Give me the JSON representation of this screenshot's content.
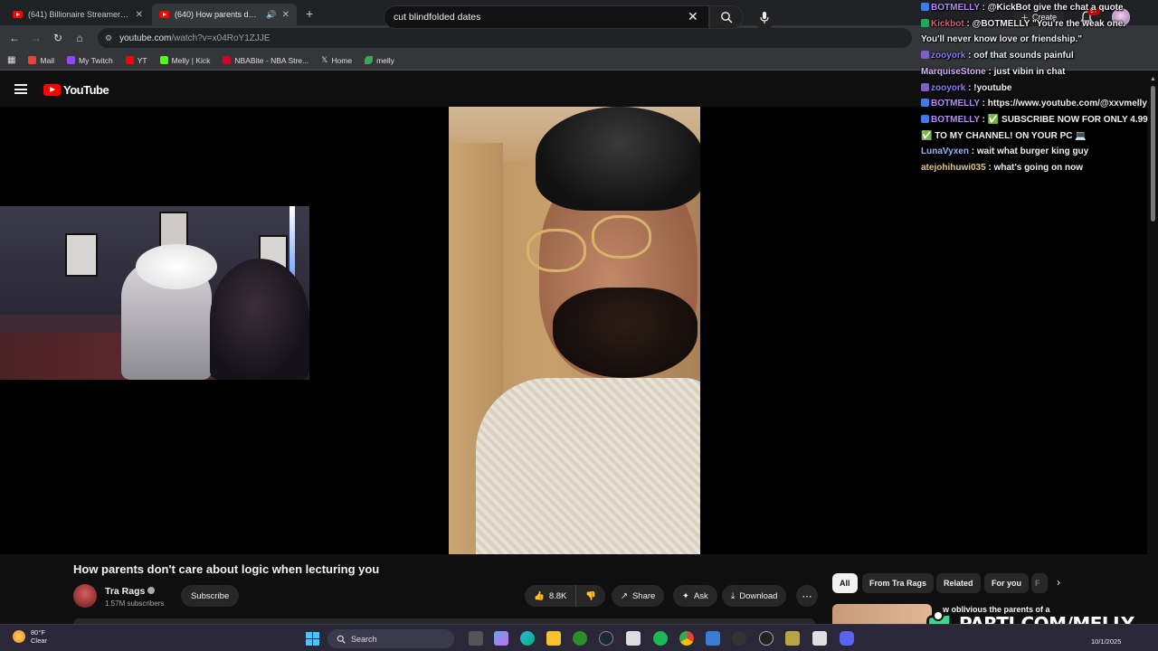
{
  "browser": {
    "tabs": [
      {
        "title": "(641) Billionaire Streamer Got C",
        "active": false
      },
      {
        "title": "(640) How parents don't ca",
        "active": true
      }
    ],
    "address": {
      "domain": "youtube.com",
      "path": "/watch?v=x04RoY1ZJJE"
    },
    "bookmarks": [
      {
        "label": "Mail",
        "icon": "gmail-icon",
        "color": "#ea4335"
      },
      {
        "label": "My Twitch",
        "icon": "twitch-icon",
        "color": "#9146ff"
      },
      {
        "label": "YT",
        "icon": "youtube-icon",
        "color": "#ff0000"
      },
      {
        "label": "Melly | Kick",
        "icon": "kick-icon",
        "color": "#53fc18"
      },
      {
        "label": "NBABite - NBA Stre...",
        "icon": "nba-icon",
        "color": "#c9082a"
      },
      {
        "label": "Home",
        "icon": "x-icon",
        "color": "#ffffff"
      },
      {
        "label": "melly",
        "icon": "leaf-icon",
        "color": "#3aa655"
      }
    ]
  },
  "youtube": {
    "logo_text": "YouTube",
    "search_query": "cut blindfolded dates",
    "create_label": "Create",
    "notification_count": "9+",
    "video": {
      "title": "How parents don't care about logic when lecturing you",
      "channel": "Tra Rags",
      "subscribers": "1.57M subscribers",
      "subscribe_label": "Subscribe",
      "likes": "8.8K",
      "share_label": "Share",
      "ask_label": "Ask",
      "download_label": "Download"
    },
    "chips": [
      "All",
      "From Tra Rags",
      "Related",
      "For you",
      "F"
    ],
    "recommendation_title": "w oblivious the parents of a"
  },
  "chat": [
    {
      "user": "BOTMELLY",
      "user_color": "#b28cff",
      "badge": "bot",
      "msg": "@KickBot give the chat a quote"
    },
    {
      "user": "Kickbot",
      "user_color": "#e05a74",
      "badge": "mod",
      "msg": "@BOTMELLY \"You're the weak one."
    },
    {
      "user": "",
      "user_color": "#efeff1",
      "badge": "",
      "msg": "You'll never know love or friendship.\""
    },
    {
      "user": "zooyork",
      "user_color": "#8a7cff",
      "badge": "sub",
      "msg": "oof that sounds painful"
    },
    {
      "user": "MarquiseStone",
      "user_color": "#d6b0ff",
      "badge": "",
      "msg": "just vibin in chat"
    },
    {
      "user": "zooyork",
      "user_color": "#8a7cff",
      "badge": "sub",
      "msg": "!youtube"
    },
    {
      "user": "BOTMELLY",
      "user_color": "#b28cff",
      "badge": "bot",
      "msg": "https://www.youtube.com/@xxvmelly"
    },
    {
      "user": "BOTMELLY",
      "user_color": "#b28cff",
      "badge": "bot",
      "msg": "✅ SUBSCRIBE NOW FOR ONLY 4.99"
    },
    {
      "user": "",
      "user_color": "#efeff1",
      "badge": "",
      "msg": "✅ TO MY CHANNEL! ON YOUR PC 💻"
    },
    {
      "user": "LunaVyxen",
      "user_color": "#8fb7ff",
      "badge": "",
      "msg": "wait what burger king guy"
    },
    {
      "user": "atejohihuwi035",
      "user_color": "#e6c38a",
      "badge": "",
      "msg": "what's going on now"
    }
  ],
  "overlay": {
    "brand": "PARTI.COM/MELLY",
    "brand_color": "#39d98a"
  },
  "taskbar": {
    "temperature": "80°F",
    "condition": "Clear",
    "search_label": "Search",
    "date": "10/1/2025"
  }
}
